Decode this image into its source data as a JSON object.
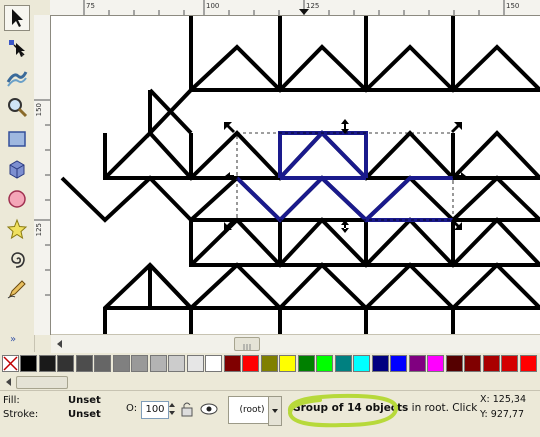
{
  "toolbox": {
    "tools": [
      "selector",
      "node",
      "tweak",
      "zoom",
      "rectangle",
      "3d-box",
      "ellipse",
      "star",
      "spiral",
      "pencil"
    ],
    "active": "selector",
    "more": "»"
  },
  "ruler": {
    "top_labels": [
      "75",
      "100",
      "125",
      "150"
    ],
    "left_labels": [
      "150",
      "125"
    ]
  },
  "palette": {
    "none_label": "X",
    "colors": [
      "#000000",
      "#1a1a1a",
      "#333333",
      "#4d4d4d",
      "#666666",
      "#808080",
      "#999999",
      "#b3b3b3",
      "#cccccc",
      "#e6e6e6",
      "#ffffff",
      "#800000",
      "#ff0000",
      "#808000",
      "#ffff00",
      "#008000",
      "#00ff00",
      "#008080",
      "#00ffff",
      "#000080",
      "#0000ff",
      "#800080",
      "#ff00ff",
      "#550000",
      "#800000",
      "#aa0000",
      "#d40000",
      "#ff0000"
    ]
  },
  "status": {
    "fill_label": "Fill:",
    "fill_value": "Unset",
    "stroke_label": "Stroke:",
    "stroke_value": "Unset",
    "opacity_label": "O:",
    "opacity_value": "100",
    "layer_value": "(root)",
    "message_bold": "Group of 14 objects",
    "message_rest": " in root. Click s...",
    "x_label": "X:",
    "x_value": "125,34",
    "y_label": "Y:",
    "y_value": "927,77"
  },
  "colors": {
    "highlight": "#b7d93a",
    "selection_path": "#1a1a8c"
  }
}
